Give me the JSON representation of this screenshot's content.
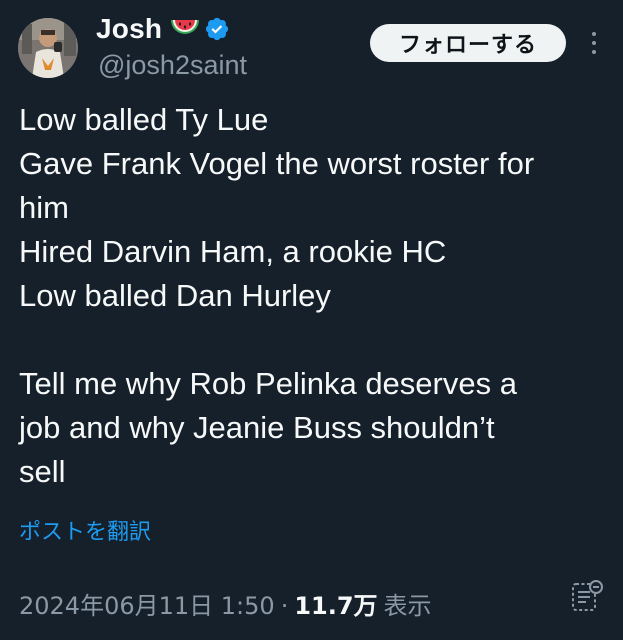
{
  "user": {
    "display_name": "Josh",
    "emoji": "watermelon-icon",
    "verified": true,
    "handle": "@josh2saint"
  },
  "follow_button": {
    "label": "フォローする"
  },
  "tweet": {
    "lines": [
      "Low balled Ty Lue",
      "Gave Frank Vogel the worst roster for",
      "him",
      "Hired Darvin Ham, a rookie HC",
      "Low balled Dan Hurley",
      "",
      "Tell me why Rob Pelinka deserves a",
      "job and why Jeanie Buss shouldn’t",
      "sell"
    ]
  },
  "translate_link": "ポストを翻訳",
  "meta": {
    "timestamp": "2024年06月11日 1:50",
    "separator": "·",
    "views_count": "11.7万",
    "views_label": "表示"
  },
  "colors": {
    "background": "#15202b",
    "text_primary": "#f7f9f9",
    "text_secondary": "#8b98a5",
    "accent": "#1d9bf0"
  }
}
